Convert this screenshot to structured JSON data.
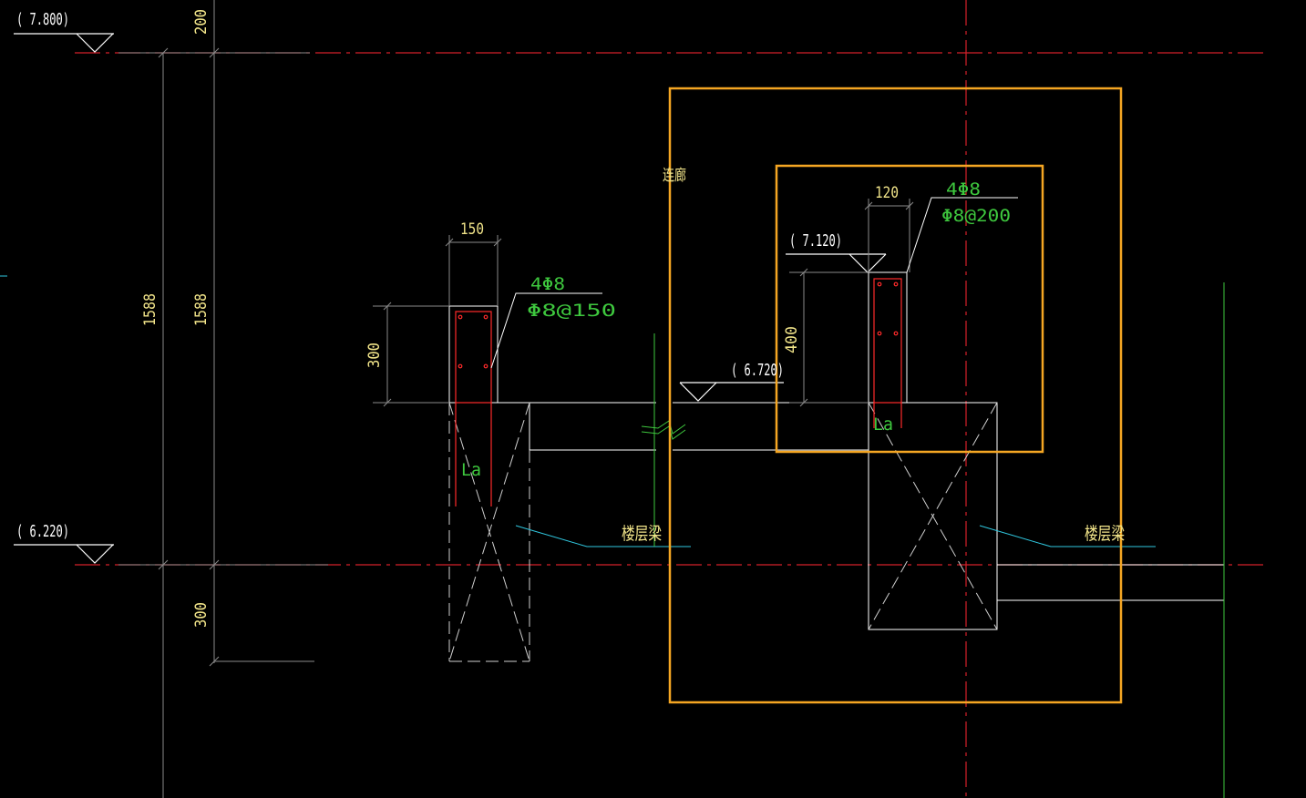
{
  "drawing": {
    "levels": {
      "top": "( 7.800)",
      "floor": "( 6.220)",
      "mid": "( 6.720)",
      "right_top": "( 7.120)"
    },
    "dimensions": {
      "d200": "200",
      "d1588_a": "1588",
      "d1588_b": "1588",
      "d300_bottom": "300",
      "d150": "150",
      "d300_left": "300",
      "d120": "120",
      "d400": "400"
    },
    "rebar": {
      "left_main": "4Φ8",
      "left_stirrup": "Φ8@150",
      "right_main": "4Φ8",
      "right_stirrup": "Φ8@200"
    },
    "labels": {
      "la_left": "La",
      "la_right": "La",
      "floor_beam_left": "楼层梁",
      "floor_beam_right": "楼层梁",
      "corridor": "连廊"
    },
    "colors": {
      "background": "#000000",
      "axis_red": "#d4202a",
      "white": "#ffffff",
      "gray": "#8a8a8a",
      "yellow_text": "#f2e58a",
      "green": "#3ec83e",
      "cyan": "#30c8e0",
      "orange": "#f5a623",
      "rebar_red": "#ff2a2a"
    }
  }
}
